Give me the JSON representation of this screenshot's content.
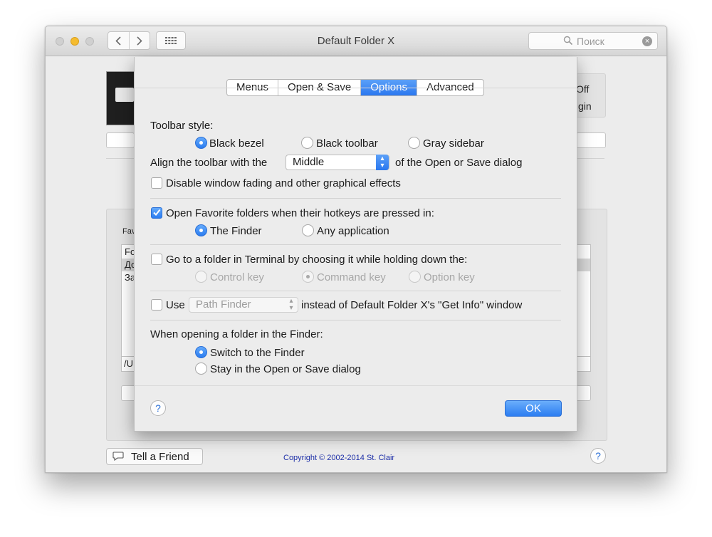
{
  "window": {
    "title": "Default Folder X",
    "search_placeholder": "Поиск"
  },
  "background": {
    "fragments": [
      "Off",
      "gin",
      "Fav",
      "Fo",
      "До",
      "За",
      "/U"
    ],
    "tell_friend_label": "Tell a Friend",
    "copyright": "Copyright © 2002-2014 St. Clair",
    "help_label": "?"
  },
  "tabs": [
    {
      "label": "Menus",
      "active": false
    },
    {
      "label": "Open & Save",
      "active": false
    },
    {
      "label": "Options",
      "active": true
    },
    {
      "label": "Advanced",
      "active": false
    }
  ],
  "toolbar_style": {
    "heading": "Toolbar style:",
    "options": [
      {
        "label": "Black bezel",
        "selected": true
      },
      {
        "label": "Black toolbar",
        "selected": false
      },
      {
        "label": "Gray sidebar",
        "selected": false
      }
    ],
    "align_prefix": "Align the toolbar with the",
    "align_value": "Middle",
    "align_suffix": "of the Open or Save dialog",
    "disable_fading_label": "Disable window fading and other graphical effects",
    "disable_fading_checked": false
  },
  "favorites": {
    "label": "Open Favorite folders when their hotkeys are pressed in:",
    "checked": true,
    "options": [
      {
        "label": "The Finder",
        "selected": true
      },
      {
        "label": "Any application",
        "selected": false
      }
    ]
  },
  "terminal": {
    "label": "Go to a folder in Terminal by choosing it while holding down the:",
    "checked": false,
    "options": [
      {
        "label": "Control key",
        "selected": false
      },
      {
        "label": "Command key",
        "selected": true
      },
      {
        "label": "Option key",
        "selected": false
      }
    ]
  },
  "get_info": {
    "use_label": "Use",
    "checked": false,
    "app_value": "Path Finder",
    "suffix": "instead of Default Folder X's \"Get Info\" window"
  },
  "finder_open": {
    "heading": "When opening a folder in the Finder:",
    "options": [
      {
        "label": "Switch to the Finder",
        "selected": true
      },
      {
        "label": "Stay in the Open or Save dialog",
        "selected": false
      }
    ]
  },
  "footer": {
    "help_label": "?",
    "ok_label": "OK"
  }
}
